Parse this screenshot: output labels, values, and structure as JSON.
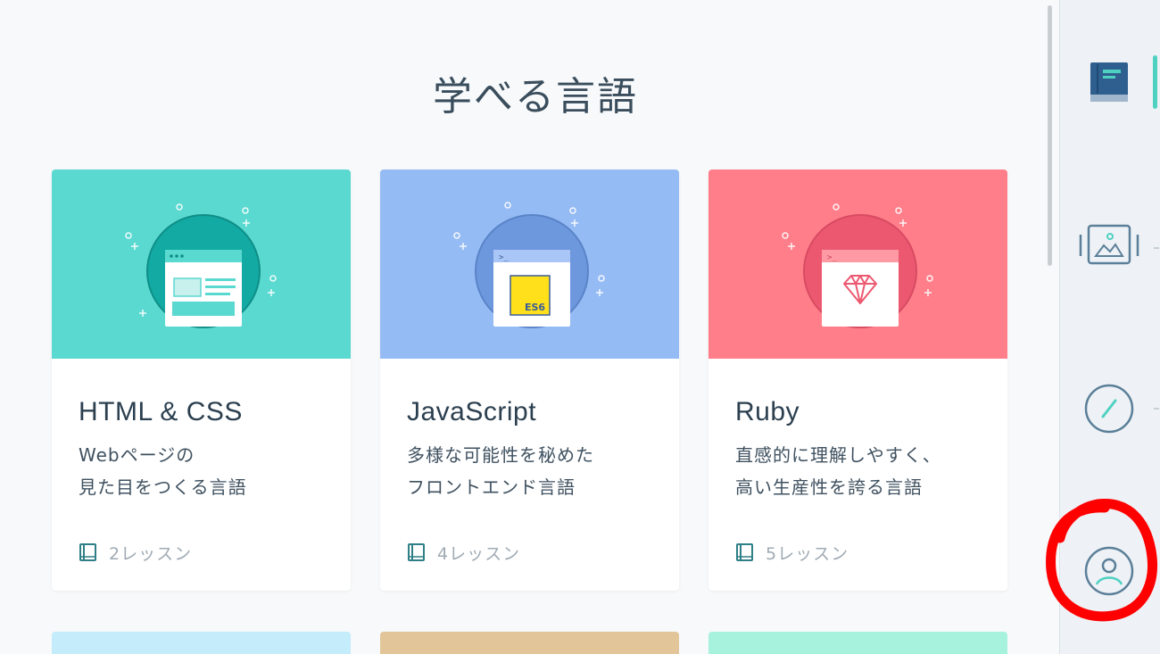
{
  "heading": "学べる言語",
  "cards": [
    {
      "title": "HTML & CSS",
      "desc_line1": "Webページの",
      "desc_line2": "見た目をつくる言語",
      "lessons": "2レッスン",
      "banner_color": "#5ad9d0",
      "illustration_badge": ""
    },
    {
      "title": "JavaScript",
      "desc_line1": "多様な可能性を秘めた",
      "desc_line2": "フロントエンド言語",
      "lessons": "4レッスン",
      "banner_color": "#95bbf4",
      "illustration_badge": "ES6"
    },
    {
      "title": "Ruby",
      "desc_line1": "直感的に理解しやすく、",
      "desc_line2": "高い生産性を誇る言語",
      "lessons": "5レッスン",
      "banner_color": "#ff7e8a",
      "illustration_badge": ""
    }
  ],
  "next_row_colors": [
    "#c4ecfb",
    "#e2c699",
    "#a6f2dc"
  ],
  "sidebar": {
    "items": [
      {
        "icon": "book-icon",
        "active": true
      },
      {
        "icon": "image-icon",
        "active": false
      },
      {
        "icon": "compass-icon",
        "active": false
      },
      {
        "icon": "user-profile-icon",
        "active": false,
        "highlighted": true
      }
    ],
    "accent_color": "#4fd1c2",
    "highlight_color": "#ff0000"
  }
}
